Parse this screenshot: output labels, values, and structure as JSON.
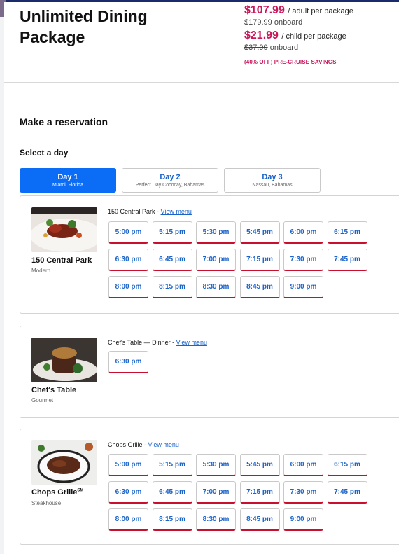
{
  "package": {
    "title": "Unlimited Dining Package",
    "adult_price": "$107.99",
    "adult_unit": "/ adult per package",
    "adult_onboard_price": "$179.99",
    "onboard_label": "onboard",
    "child_price": "$21.99",
    "child_unit": "/ child per package",
    "child_onboard_price": "$37.99",
    "savings": "(40% OFF) PRE-CRUISE SAVINGS"
  },
  "reservation": {
    "title": "Make a reservation",
    "select_day": "Select a day"
  },
  "days": [
    {
      "name": "Day 1",
      "port": "Miami, Florida",
      "active": true
    },
    {
      "name": "Day 2",
      "port": "Perfect Day Cococay, Bahamas",
      "active": false
    },
    {
      "name": "Day 3",
      "port": "Nassau, Bahamas",
      "active": false
    }
  ],
  "venues": [
    {
      "name": "150 Central Park",
      "type": "Modern",
      "menu_title": "150 Central Park - ",
      "menu_link": "View menu",
      "times": [
        "5:00 pm",
        "5:15 pm",
        "5:30 pm",
        "5:45 pm",
        "6:00 pm",
        "6:15 pm",
        "6:30 pm",
        "6:45 pm",
        "7:00 pm",
        "7:15 pm",
        "7:30 pm",
        "7:45 pm",
        "8:00 pm",
        "8:15 pm",
        "8:30 pm",
        "8:45 pm",
        "9:00 pm"
      ]
    },
    {
      "name": "Chef's Table",
      "type": "Gourmet",
      "menu_title": "Chef's Table — Dinner - ",
      "menu_link": "View menu",
      "times": [
        "6:30 pm"
      ]
    },
    {
      "name": "Chops Grille",
      "name_sup": "SM",
      "type": "Steakhouse",
      "menu_title": "Chops Grille - ",
      "menu_link": "View menu",
      "times": [
        "5:00 pm",
        "5:15 pm",
        "5:30 pm",
        "5:45 pm",
        "6:00 pm",
        "6:15 pm",
        "6:30 pm",
        "6:45 pm",
        "7:00 pm",
        "7:15 pm",
        "7:30 pm",
        "7:45 pm",
        "8:00 pm",
        "8:15 pm",
        "8:30 pm",
        "8:45 pm",
        "9:00 pm"
      ]
    }
  ],
  "colors": {
    "accent_blue": "#0b6cf5",
    "link_blue": "#1a63c9",
    "price_pink": "#c8185c",
    "slot_underline": "#c8102e"
  }
}
